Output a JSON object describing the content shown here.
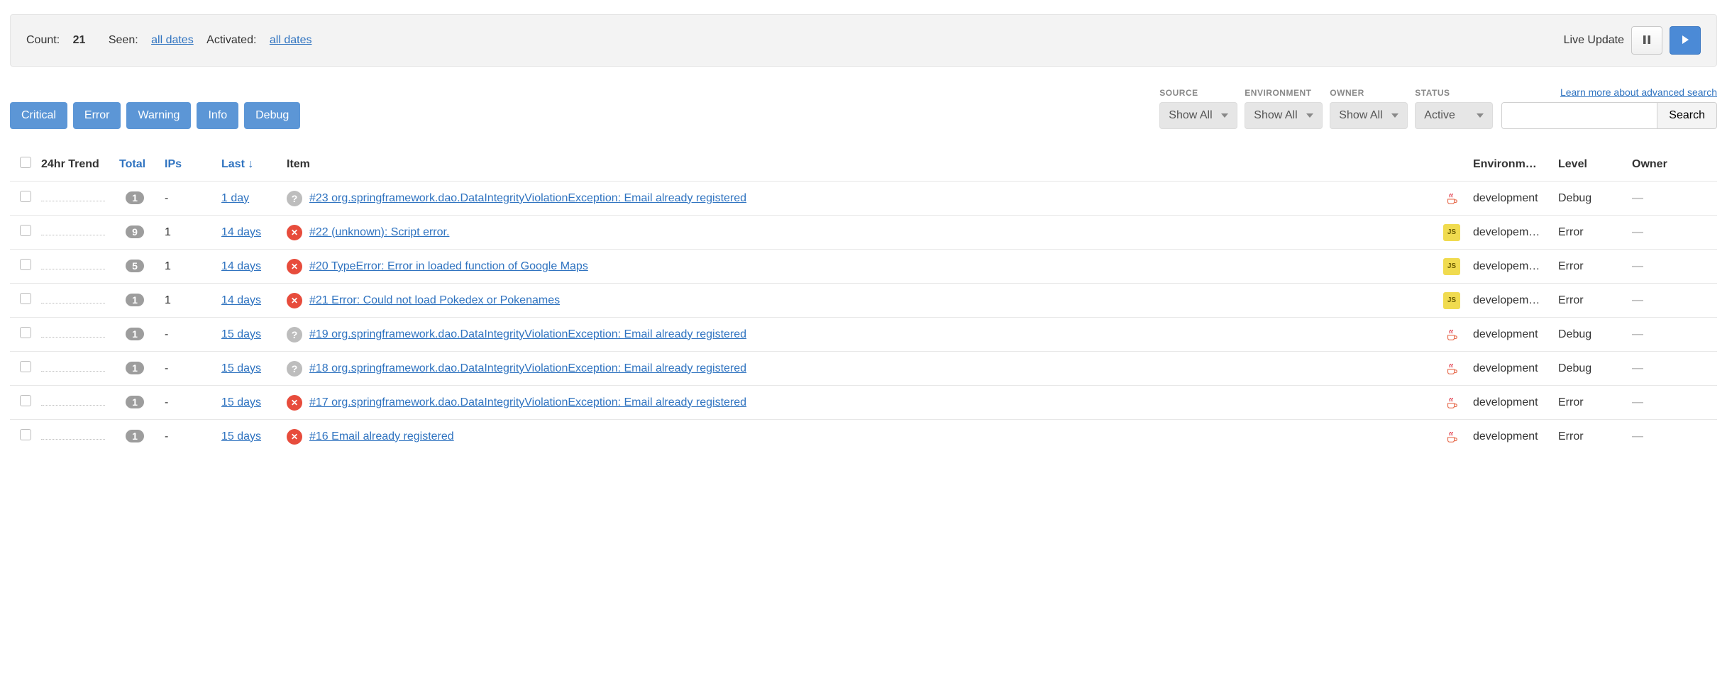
{
  "status": {
    "count_label": "Count:",
    "count_value": "21",
    "seen_label": "Seen:",
    "seen_value": "all dates",
    "activated_label": "Activated:",
    "activated_value": "all dates",
    "live_update": "Live Update"
  },
  "levels": [
    "Critical",
    "Error",
    "Warning",
    "Info",
    "Debug"
  ],
  "filters": [
    {
      "label": "SOURCE",
      "value": "Show All"
    },
    {
      "label": "ENVIRONMENT",
      "value": "Show All"
    },
    {
      "label": "OWNER",
      "value": "Show All"
    },
    {
      "label": "STATUS",
      "value": "Active"
    }
  ],
  "search": {
    "help": "Learn more about advanced search",
    "button": "Search",
    "placeholder": ""
  },
  "columns": {
    "trend": "24hr Trend",
    "total": "Total",
    "ips": "IPs",
    "last": "Last ↓",
    "item": "Item",
    "env": "Environm…",
    "level": "Level",
    "owner": "Owner"
  },
  "rows": [
    {
      "total": "1",
      "ips": "-",
      "last": "1 day",
      "status": "debug",
      "title": "#23 org.springframework.dao.DataIntegrityViolationException: Email already registered",
      "lang": "java",
      "env": "development",
      "level": "Debug",
      "owner": "—"
    },
    {
      "total": "9",
      "ips": "1",
      "last": "14 days",
      "status": "error",
      "title": "#22 (unknown): Script error.",
      "lang": "js",
      "env": "developem…",
      "level": "Error",
      "owner": "—"
    },
    {
      "total": "5",
      "ips": "1",
      "last": "14 days",
      "status": "error",
      "title": "#20 TypeError: Error in loaded function of Google Maps",
      "lang": "js",
      "env": "developem…",
      "level": "Error",
      "owner": "—"
    },
    {
      "total": "1",
      "ips": "1",
      "last": "14 days",
      "status": "error",
      "title": "#21 Error: Could not load Pokedex or Pokenames",
      "lang": "js",
      "env": "developem…",
      "level": "Error",
      "owner": "—"
    },
    {
      "total": "1",
      "ips": "-",
      "last": "15 days",
      "status": "debug",
      "title": "#19 org.springframework.dao.DataIntegrityViolationException: Email already registered",
      "lang": "java",
      "env": "development",
      "level": "Debug",
      "owner": "—"
    },
    {
      "total": "1",
      "ips": "-",
      "last": "15 days",
      "status": "debug",
      "title": "#18 org.springframework.dao.DataIntegrityViolationException: Email already registered",
      "lang": "java",
      "env": "development",
      "level": "Debug",
      "owner": "—"
    },
    {
      "total": "1",
      "ips": "-",
      "last": "15 days",
      "status": "error",
      "title": "#17 org.springframework.dao.DataIntegrityViolationException: Email already registered",
      "lang": "java",
      "env": "development",
      "level": "Error",
      "owner": "—"
    },
    {
      "total": "1",
      "ips": "-",
      "last": "15 days",
      "status": "error",
      "title": "#16 Email already registered",
      "lang": "java",
      "env": "development",
      "level": "Error",
      "owner": "—"
    }
  ]
}
